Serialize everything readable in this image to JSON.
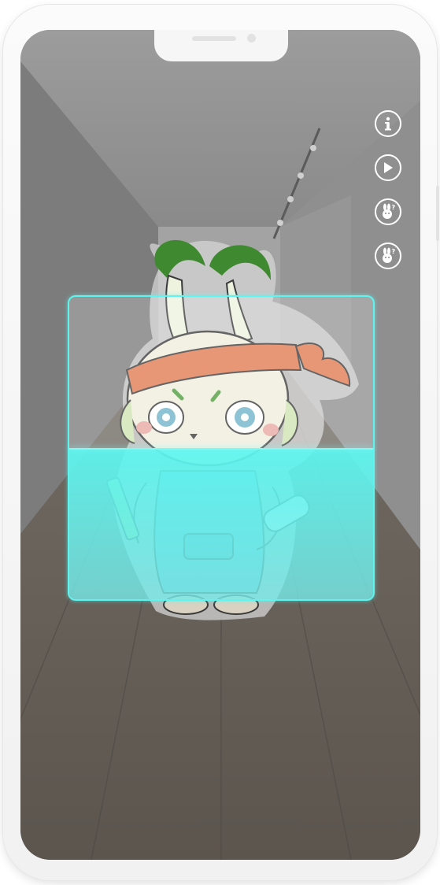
{
  "camera_view": {
    "subject": "rabbit-mascot-sticker"
  },
  "toolbar": {
    "items": [
      {
        "id": "info",
        "icon": "info-icon"
      },
      {
        "id": "play",
        "icon": "play-icon"
      },
      {
        "id": "help-1",
        "icon": "rabbit-help-icon"
      },
      {
        "id": "help-2",
        "icon": "rabbit-help-icon"
      }
    ]
  },
  "scanner": {
    "frame_color": "#5ff4ee",
    "progress": 0.5
  },
  "colors": {
    "scan_accent": "#5ff4ee",
    "headband": "#e07a4f",
    "overalls": "#6fb3c9",
    "ears_green": "#4e9a3a"
  }
}
